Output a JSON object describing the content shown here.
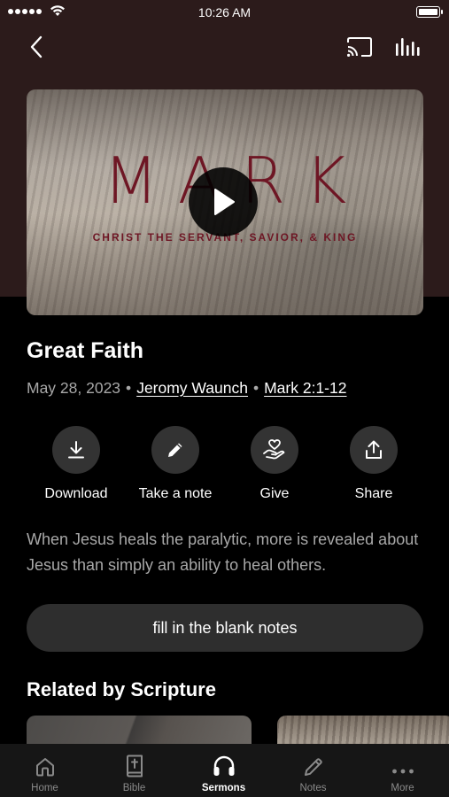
{
  "status_bar": {
    "time": "10:26 AM"
  },
  "top_nav": {
    "back_icon": "chevron-left-icon",
    "cast_icon": "cast-icon",
    "audio_icon": "audio-bars-icon"
  },
  "video": {
    "title": "MARK",
    "subtitle": "CHRIST THE SERVANT, SAVIOR, & KING",
    "title_color": "#6e1624"
  },
  "sermon": {
    "title": "Great Faith",
    "date": "May 28, 2023",
    "separator": "•",
    "speaker": "Jeromy Waunch",
    "passage": "Mark 2:1-12",
    "description": "When Jesus heals the paralytic, more is revealed about Jesus than simply an ability to heal others."
  },
  "actions": [
    {
      "label": "Download",
      "icon": "download-icon"
    },
    {
      "label": "Take a note",
      "icon": "pencil-icon"
    },
    {
      "label": "Give",
      "icon": "give-heart-icon"
    },
    {
      "label": "Share",
      "icon": "share-icon"
    }
  ],
  "notes_button": {
    "label": "fill in the blank notes"
  },
  "related": {
    "heading": "Related by Scripture"
  },
  "tab_bar": {
    "tabs": [
      {
        "label": "Home",
        "icon": "home-icon"
      },
      {
        "label": "Bible",
        "icon": "bible-icon"
      },
      {
        "label": "Sermons",
        "icon": "headphones-icon",
        "active": true
      },
      {
        "label": "Notes",
        "icon": "pencil-icon"
      },
      {
        "label": "More",
        "icon": "more-dots-icon"
      }
    ]
  },
  "colors": {
    "hero_background": "#2c1b1b",
    "surface": "#2e2e2e",
    "tab_bar": "#161616",
    "secondary_text": "#a8a8a8"
  }
}
